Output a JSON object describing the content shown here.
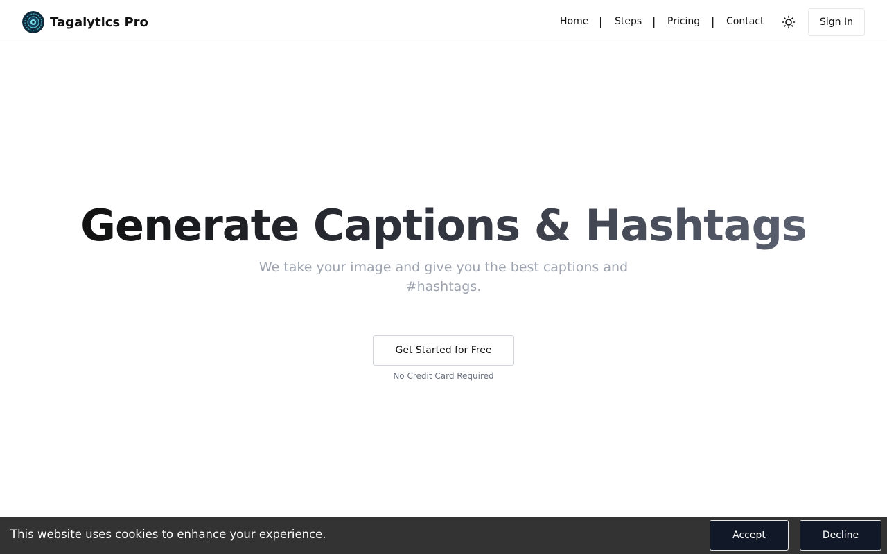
{
  "header": {
    "brand_name": "Tagalytics Pro",
    "nav": [
      "Home",
      "Steps",
      "Pricing",
      "Contact"
    ],
    "separator": "|",
    "theme_icon": "sun-icon",
    "sign_in_label": "Sign In"
  },
  "hero": {
    "title": "Generate Captions & Hashtags",
    "subtitle": "We take your image and give you the best captions and #hashtags.",
    "cta_label": "Get Started for Free",
    "cta_note": "No Credit Card Required"
  },
  "cookie_banner": {
    "message": "This website uses cookies to enhance your experience.",
    "accept_label": "Accept",
    "decline_label": "Decline"
  },
  "colors": {
    "cookie_bar_bg": "#333333",
    "cookie_button_bg": "#111827",
    "subtitle_text": "#9ca3af",
    "border": "#e5e7eb"
  }
}
